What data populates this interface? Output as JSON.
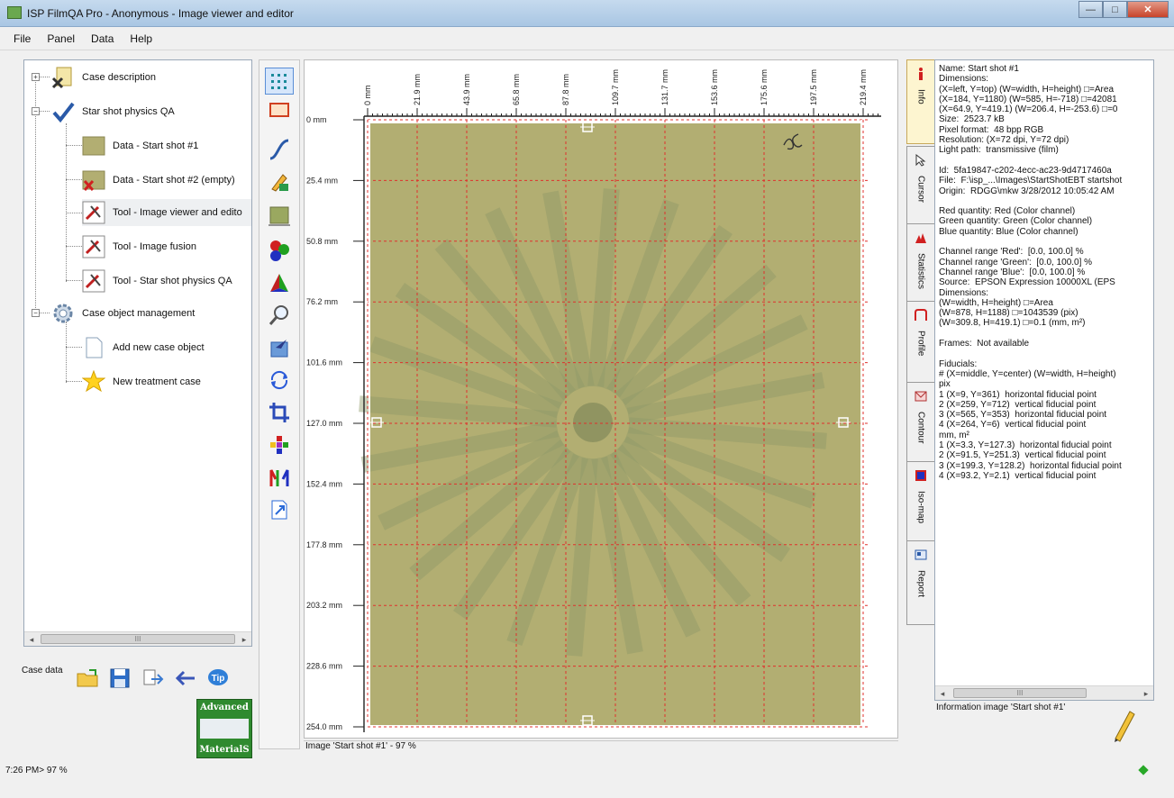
{
  "window": {
    "title": "ISP FilmQA Pro - Anonymous - Image viewer and editor",
    "min_label": "—",
    "max_label": "□",
    "close_label": "✕"
  },
  "menu": [
    "File",
    "Panel",
    "Data",
    "Help"
  ],
  "tree": {
    "items": [
      {
        "label": "Case description",
        "icon": "case-description-icon"
      },
      {
        "label": "Star shot physics QA",
        "icon": "checkmark-icon"
      },
      {
        "label": "Data - Start shot #1",
        "icon": "film-data-icon"
      },
      {
        "label": "Data - Start shot #2 (empty)",
        "icon": "film-empty-icon"
      },
      {
        "label": "Tool - Image viewer and edito",
        "icon": "tool-icon"
      },
      {
        "label": "Tool - Image fusion",
        "icon": "tool-icon"
      },
      {
        "label": "Tool - Star shot physics QA",
        "icon": "tool-icon"
      },
      {
        "label": "Case object management",
        "icon": "gear-icon"
      },
      {
        "label": "Add new case object",
        "icon": "new-document-icon"
      },
      {
        "label": "New treatment case",
        "icon": "starburst-icon"
      }
    ],
    "scroll_grip": "III"
  },
  "case_data": {
    "label": "Case data",
    "buttons": [
      "open-folder-icon",
      "save-icon",
      "export-icon",
      "back-arrow-icon",
      "tip-icon"
    ],
    "tip_text": "Tip"
  },
  "logo": {
    "line1": "Advanced",
    "line2": "MaterialS"
  },
  "tools": [
    "grid-points-icon",
    "red-rect-icon",
    "curve-icon",
    "pencil-color-icon",
    "film-thumb-icon",
    "rgb-balls-icon",
    "pyramid-icon",
    "magnifier-icon",
    "import-arrow-icon",
    "rotate-icon",
    "crop-icon",
    "color-dots-icon",
    "channels-icon",
    "export-doc-icon"
  ],
  "viewer": {
    "x_ticks": [
      "0 mm",
      "21.9 mm",
      "43.9 mm",
      "65.8 mm",
      "87.8 mm",
      "109.7 mm",
      "131.7 mm",
      "153.6 mm",
      "175.6 mm",
      "197.5 mm",
      "219.4 mm"
    ],
    "y_ticks": [
      "0 mm",
      "25.4 mm",
      "50.8 mm",
      "76.2 mm",
      "101.6 mm",
      "127.0 mm",
      "152.4 mm",
      "177.8 mm",
      "203.2 mm",
      "228.6 mm",
      "254.0 mm"
    ],
    "status": "Image 'Start shot #1' - 97 %",
    "film_color": "#b2ae72",
    "grid_color": "#e0302c"
  },
  "side_tabs": [
    {
      "label": "Info",
      "icon": "info-icon",
      "active": true
    },
    {
      "label": "Cursor",
      "icon": "cursor-icon"
    },
    {
      "label": "Statistics",
      "icon": "statistics-icon"
    },
    {
      "label": "Profile",
      "icon": "profile-icon"
    },
    {
      "label": "Contour",
      "icon": "contour-icon"
    },
    {
      "label": "Iso-map",
      "icon": "isomap-icon"
    },
    {
      "label": "Report",
      "icon": "report-icon"
    }
  ],
  "info": {
    "lines": [
      "Name: Start shot #1",
      "Dimensions:",
      "(X=left, Y=top) (W=width, H=height) □=Area",
      "(X=184, Y=1180) (W=585, H=-718) □=42081",
      "(X=64.9, Y=419.1) (W=206.4, H=-253.6) □=0",
      "Size:  2523.7 kB",
      "Pixel format:  48 bpp RGB",
      "Resolution: (X=72 dpi, Y=72 dpi)",
      "Light path:  transmissive (film)",
      "",
      "Id:  5fa19847-c202-4ecc-ac23-9d4717460a",
      "File:  F:\\isp_...\\Images\\StartShotEBT startshot",
      "Origin:  RDGG\\mkw 3/28/2012 10:05:42 AM",
      "",
      "Red quantity: Red (Color channel)",
      "Green quantity: Green (Color channel)",
      "Blue quantity: Blue (Color channel)",
      "",
      "Channel range 'Red':  [0.0, 100.0] %",
      "Channel range 'Green':  [0.0, 100.0] %",
      "Channel range 'Blue':  [0.0, 100.0] %",
      "Source:  EPSON Expression 10000XL (EPS",
      "Dimensions:",
      "(W=width, H=height) □=Area",
      "(W=878, H=1188) □=1043539 (pix)",
      "(W=309.8, H=419.1) □=0.1 (mm, m²)",
      "",
      "Frames:  Not available",
      "",
      "Fiducials:",
      "# (X=middle, Y=center) (W=width, H=height)",
      "pix",
      "1 (X=9, Y=361)  horizontal fiducial point",
      "2 (X=259, Y=712)  vertical fiducial point",
      "3 (X=565, Y=353)  horizontal fiducial point",
      "4 (X=264, Y=6)  vertical fiducial point",
      "mm, m²",
      "1 (X=3.3, Y=127.3)  horizontal fiducial point",
      "2 (X=91.5, Y=251.3)  vertical fiducial point",
      "3 (X=199.3, Y=128.2)  horizontal fiducial point",
      "4 (X=93.2, Y=2.1)  vertical fiducial point"
    ],
    "caption": "Information image 'Start shot #1'",
    "scroll_grip": "III"
  },
  "status": {
    "text": "7:26 PM> 97 %"
  }
}
